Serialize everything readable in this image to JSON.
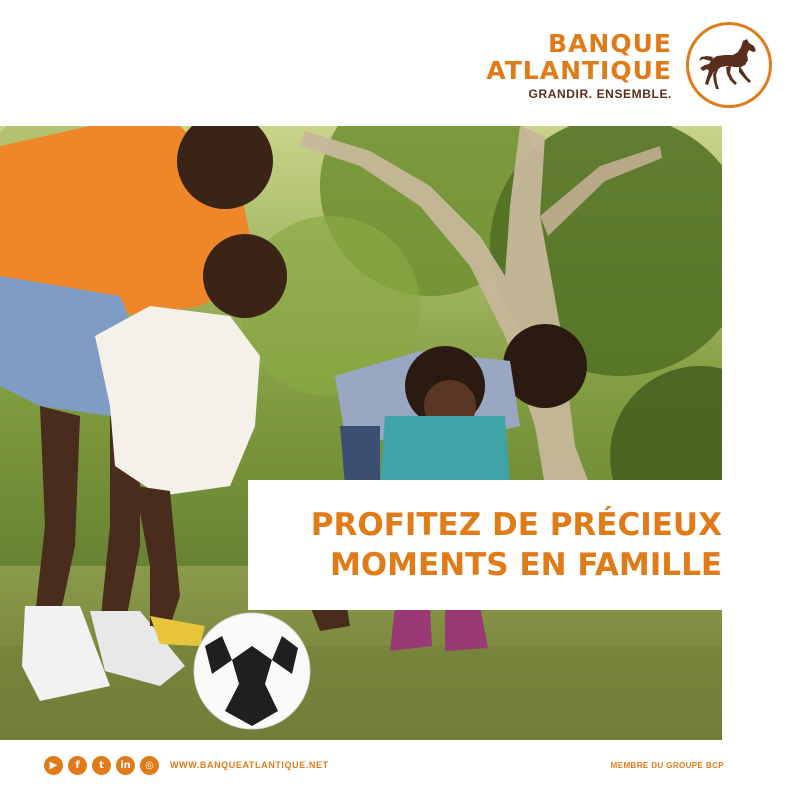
{
  "brand": {
    "line1": "BANQUE",
    "line2": "ATLANTIQUE",
    "tagline": "GRANDIR. ENSEMBLE.",
    "logo_icon": "horse-icon"
  },
  "photo": {
    "icon": "family-playing-soccer-photo"
  },
  "headline": {
    "line1": "PROFITEZ DE PRÉCIEUX",
    "line2": "MOMENTS EN FAMILLE"
  },
  "footer": {
    "social": [
      {
        "name": "youtube-icon",
        "glyph": "▶"
      },
      {
        "name": "facebook-icon",
        "glyph": "f"
      },
      {
        "name": "twitter-icon",
        "glyph": "t"
      },
      {
        "name": "linkedin-icon",
        "glyph": "in"
      },
      {
        "name": "instagram-icon",
        "glyph": "◎"
      }
    ],
    "website": "WWW.BANQUEATLANTIQUE.NET",
    "member": "MEMBRE DU GROUPE BCP"
  },
  "colors": {
    "accent": "#e07b1a",
    "dark_brown": "#5a2e1c"
  }
}
